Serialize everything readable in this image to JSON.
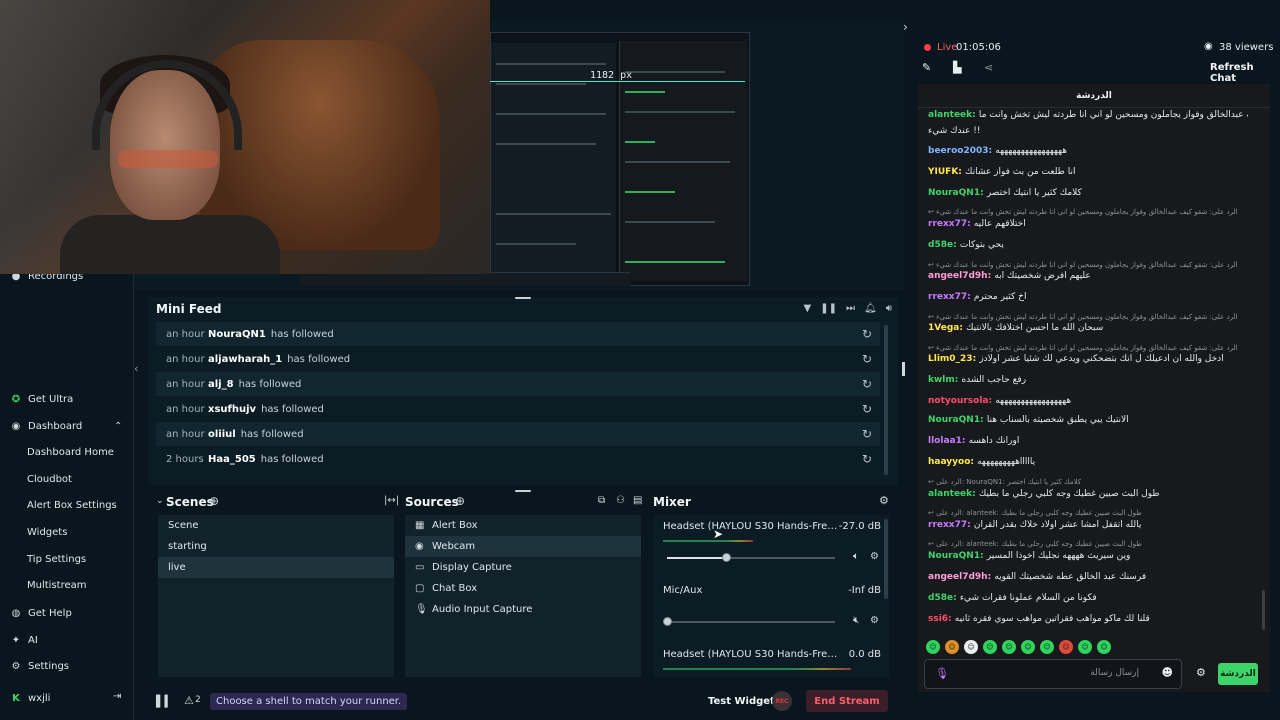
{
  "window": {
    "minimize": "–",
    "maximize": "☐",
    "close": "✕",
    "expand_arrow": "›"
  },
  "sidebar": {
    "recordings": "Recordings",
    "get_ultra": "Get Ultra",
    "dashboard": "Dashboard",
    "sub_items": [
      "Dashboard Home",
      "Cloudbot",
      "Alert Box Settings",
      "Widgets",
      "Tip Settings",
      "Multistream"
    ],
    "get_help": "Get Help",
    "ai": "AI",
    "settings": "Settings",
    "user": "wxjli"
  },
  "preview": {
    "ruler_label": "1182 px"
  },
  "mini_feed": {
    "title": "Mini Feed",
    "rows": [
      {
        "time": "an hour",
        "name": "NouraQN1",
        "action": "has followed"
      },
      {
        "time": "an hour",
        "name": "aljawharah_1",
        "action": "has followed"
      },
      {
        "time": "an hour",
        "name": "alj_8",
        "action": "has followed"
      },
      {
        "time": "an hour",
        "name": "xsufhujv",
        "action": "has followed"
      },
      {
        "time": "an hour",
        "name": "oliiul",
        "action": "has followed"
      },
      {
        "time": "2 hours",
        "name": "Haa_505",
        "action": "has followed"
      }
    ]
  },
  "scenes": {
    "title": "Scenes",
    "items": [
      "Scene",
      "starting",
      "live"
    ],
    "selected": "live"
  },
  "sources": {
    "title": "Sources",
    "items": [
      {
        "label": "Alert Box",
        "icon": "alert-icon"
      },
      {
        "label": "Webcam",
        "icon": "camera-icon"
      },
      {
        "label": "Display Capture",
        "icon": "monitor-icon"
      },
      {
        "label": "Chat Box",
        "icon": "chat-icon"
      },
      {
        "label": "Audio Input Capture",
        "icon": "mic-icon"
      }
    ],
    "selected": "Webcam"
  },
  "mixer": {
    "title": "Mixer",
    "items": [
      {
        "name": "Headset (HAYLOU S30 Hands-Free AG Audio)",
        "db": "-27.0 dB",
        "level": 0.35
      },
      {
        "name": "Mic/Aux",
        "db": "-Inf dB",
        "level": 0.0
      },
      {
        "name": "Headset (HAYLOU S30 Hands-Free AG Audio)",
        "db": "0.0 dB",
        "level": 1.0
      }
    ]
  },
  "statusbar": {
    "alerts": "2",
    "tip": "Choose a shell to match your runner.",
    "test_widgets": "Test Widgets",
    "rec": "REC",
    "end_stream": "End Stream"
  },
  "stream": {
    "live_label": "Live",
    "uptime": "01:05:06",
    "viewers": "38 viewers",
    "refresh_chat": "Refresh Chat"
  },
  "chat": {
    "header": "الدردشة",
    "messages": [
      {
        "user": "alanteek",
        "color": "#3fd46a",
        "text": "شغو كيف عبدالخالق وفواز يجاملون ومسحين لو اني انا طردته ليش تخش وانت ما"
      },
      {
        "user": "",
        "color": "",
        "text": "عندك شيء !!"
      },
      {
        "user": "beeroo2003",
        "color": "#7fb6ff",
        "text": "ههههههههههههههههه"
      },
      {
        "user": "YIUFK",
        "color": "#ffe94d",
        "text": "انا طلعت من بث فواز عشانك"
      },
      {
        "user": "NouraQN1",
        "color": "#3fd46a",
        "text": "كلامك كثير يا أنتيك اختصر"
      },
      {
        "user": "rrexx77",
        "color": "#c67bff",
        "text": "اختلاقهم عاليه"
      },
      {
        "user": "d58e",
        "color": "#3fd46a",
        "text": "يحي بتوكات"
      },
      {
        "user": "angeel7d9h",
        "color": "#ff9ed8",
        "text": "عليهم افرض شخصيتك ابه"
      },
      {
        "user": "rrexx77",
        "color": "#c67bff",
        "text": "اخ كثير محترم"
      },
      {
        "user": "1Vega",
        "color": "#ffe94d",
        "text": "سبحان الله ما احسن اختلافك بالانتيك"
      },
      {
        "user": "Llim0_23",
        "color": "#ffe94d",
        "text": "ادخل والله ان ادعيلك ل انك بتضحكني ويدعي لك شئيا عشر اولادز"
      },
      {
        "user": "kwlm",
        "color": "#3fd46a",
        "text": "رفع حاجب الشده"
      },
      {
        "user": "notyoursola",
        "color": "#ff4d6d",
        "text": "هههههههههههههههههه"
      },
      {
        "user": "NouraQN1",
        "color": "#3fd46a",
        "text": "الانتيك يبي يطبق شخصيته بالسناب هنا"
      },
      {
        "user": "llolaa1",
        "color": "#c67bff",
        "text": "اورانك داهسه"
      },
      {
        "user": "haayyoo",
        "color": "#ffe94d",
        "text": "ياااااهههههههههه"
      },
      {
        "user": "alanteek",
        "color": "#3fd46a",
        "text": "طول البث صيين غطيك وجه كلبي رجلي ما بطيك"
      },
      {
        "user": "rrexx77",
        "color": "#c67bff",
        "text": "يالله اتقفل امشا عشر اولاد خلاك بقدر القرآن"
      },
      {
        "user": "NouraQN1",
        "color": "#3fd46a",
        "text": "وين سيريث ههههه نجليك اخوذا المسير"
      },
      {
        "user": "angeel7d9h",
        "color": "#ff9ed8",
        "text": "فرسنك عبد الخالق عطه شخصيتك القويه"
      },
      {
        "user": "d58e",
        "color": "#3fd46a",
        "text": "فكونا من السلام عملونا فقرات شيء"
      },
      {
        "user": "ssi6",
        "color": "#ff4d6d",
        "text": "قلنا لك ماكو مواهب فقراتين مواهب سوي فقره ثانيه"
      }
    ],
    "replies": [
      "الرد على: شقو كيف عبدالخالق وفواز يجاملون ومسحين لو اني انا طردته ليش تخش وانت ما عندك شيء",
      "الرد على: شقو كيف عبدالخالق وفواز يجاملون ومسحين لو اني انا طردته ليش تخش وانت ما عندك شيء",
      "الرد على: شقو كيف عبدالخالق وفواز يجاملون ومسحين لو اني انا طردته ليش تخش وانت ما عندك شيء",
      "الرد على: شقو كيف عبدالخالق وفواز يجاملون ومسحين لو اني انا طردته ليش تخش وانت ما عندك شيء",
      "الرد على: NouraQN1: كلامك كثير يا انتيك اختصر",
      "الرد على: alanteek: طول البث صيين غطيك وجه كلبي رجلي ما بطيك",
      "الرد على: alanteek: طول البث صيين غطيك وجه كلبي رجلي ما بطيك"
    ],
    "input_placeholder": "إرسال رسالة",
    "send_label": "الدردشة"
  }
}
